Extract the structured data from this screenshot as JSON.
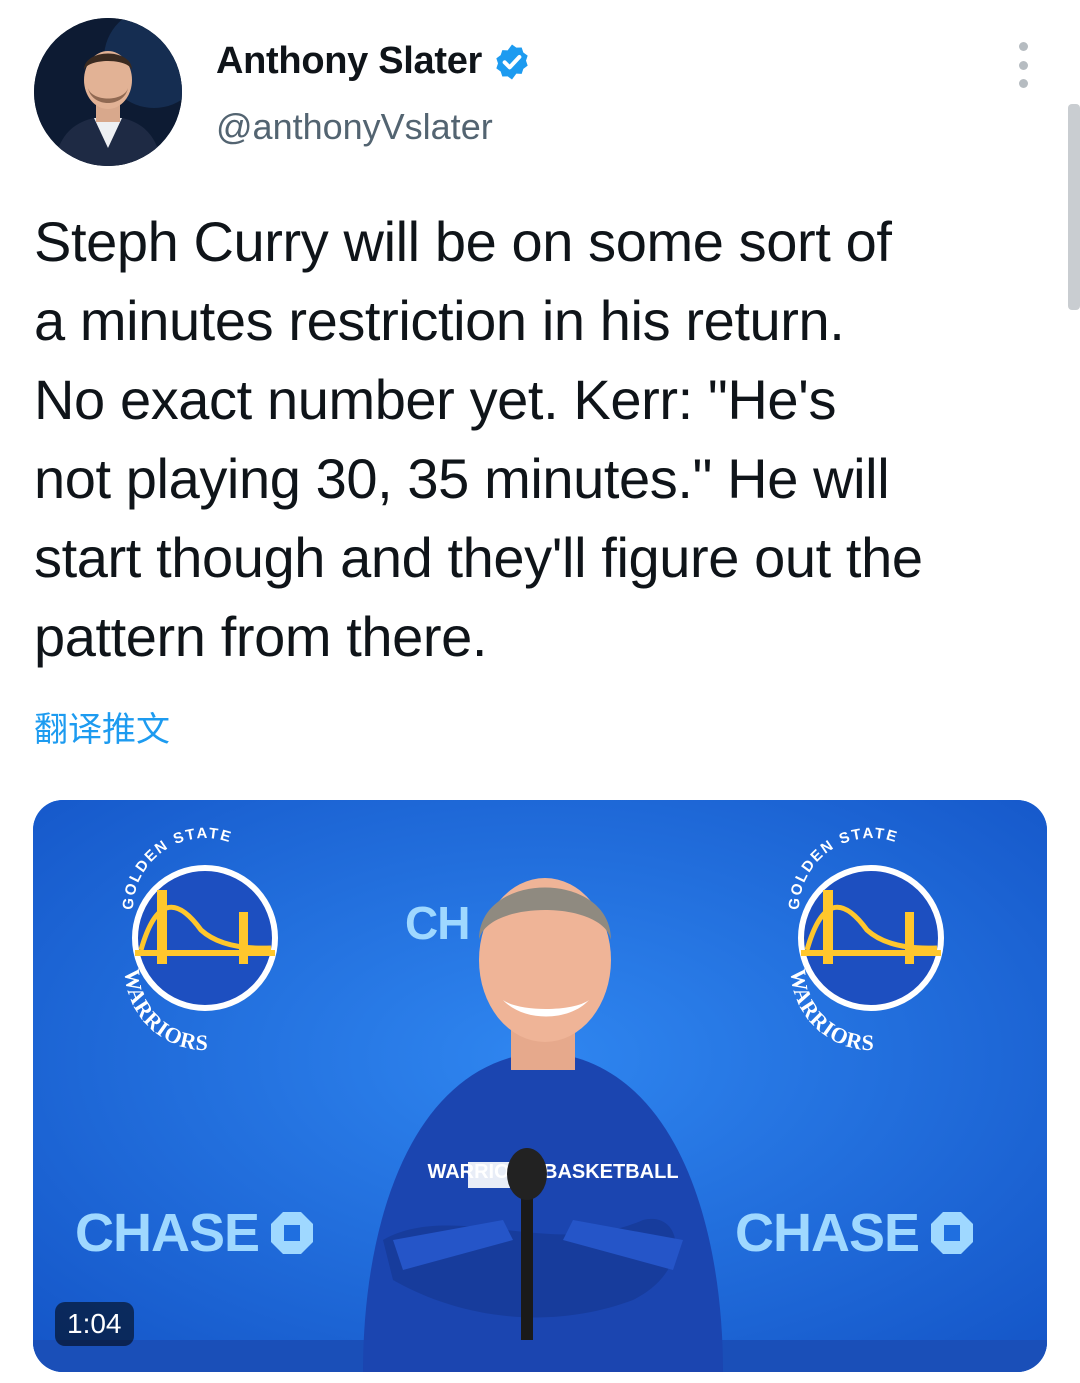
{
  "author": {
    "name": "Anthony Slater",
    "handle": "@anthonyVslater",
    "verified": true
  },
  "tweet": {
    "text": "Steph Curry will be on some sort of\na minutes restriction in his return.\nNo exact number yet. Kerr: \"He's\nnot playing 30, 35 minutes.\" He will\nstart though and they'll figure out the\npattern from there.",
    "translate_label": "翻译推文"
  },
  "media": {
    "type": "video",
    "duration": "1:04",
    "sponsor_text": "CHASE",
    "sponsor_partial": "CH",
    "logo_top_text": "GOLDEN STATE",
    "logo_bottom_text": "WARRIORS",
    "shirt_text": "WARRIORS BASKETBALL"
  },
  "colors": {
    "accent": "#1d9bf0",
    "media_bg": "#1f6fe0",
    "warriors_gold": "#ffc72c",
    "warriors_blue": "#1d428a"
  },
  "icons": {
    "verified": "verified-badge-icon",
    "more": "more-options-icon"
  }
}
